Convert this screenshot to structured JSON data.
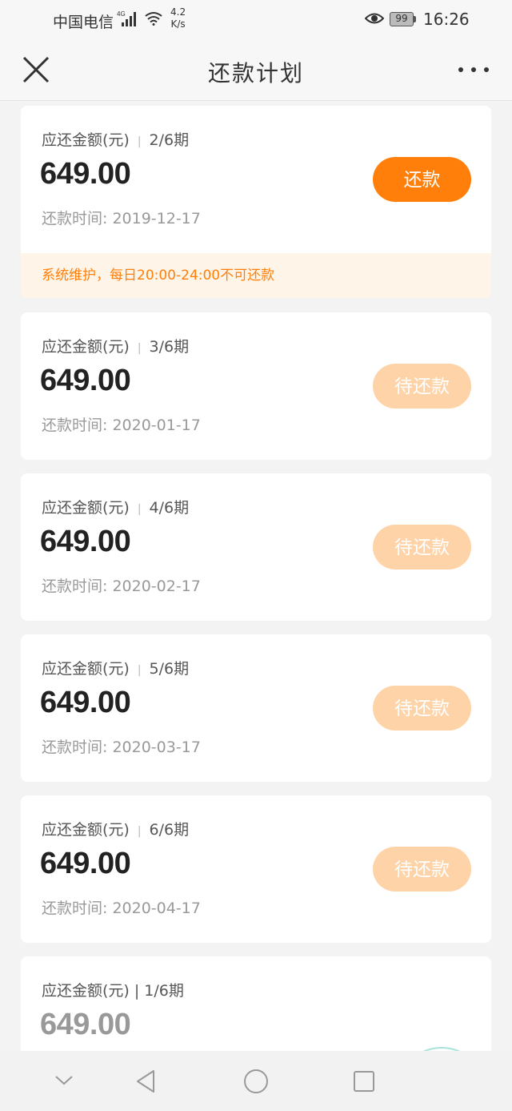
{
  "status_bar": {
    "carrier": "中国电信",
    "network": "4G",
    "speed_value": "4.2",
    "speed_unit": "K/s",
    "battery": "99",
    "time": "16:26"
  },
  "nav": {
    "title": "还款计划"
  },
  "plan": {
    "amount_label": "应还金额(元)",
    "date_prefix": "还款时间:",
    "notice": "系统维护，每日20:00-24:00不可还款",
    "items": [
      {
        "period": "2/6期",
        "amount": "649.00",
        "date": "还款时间: 2019-12-17",
        "button": "还款"
      },
      {
        "period": "3/6期",
        "amount": "649.00",
        "date": "还款时间: 2020-01-17",
        "button": "待还款"
      },
      {
        "period": "4/6期",
        "amount": "649.00",
        "date": "还款时间: 2020-02-17",
        "button": "待还款"
      },
      {
        "period": "5/6期",
        "amount": "649.00",
        "date": "还款时间: 2020-03-17",
        "button": "待还款"
      },
      {
        "period": "6/6期",
        "amount": "649.00",
        "date": "还款时间: 2020-04-17",
        "button": "待还款"
      },
      {
        "head": "应还金额(元) | 1/6期",
        "amount": "649.00"
      }
    ]
  },
  "colors": {
    "accent": "#ff7f0a",
    "pending": "#ffd3a8",
    "notice_bg": "#fff4e8"
  }
}
